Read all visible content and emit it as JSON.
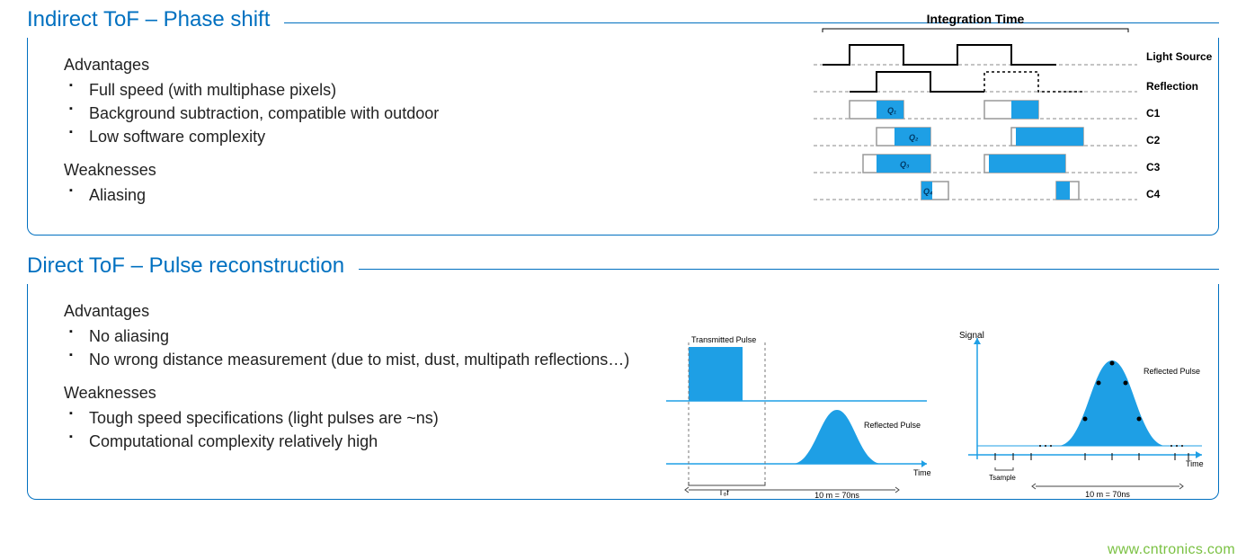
{
  "sections": [
    {
      "title": "Indirect ToF – Phase shift",
      "advantages_label": "Advantages",
      "advantages": [
        "Full speed (with multiphase pixels)",
        "Background subtraction, compatible with outdoor",
        "Low software complexity"
      ],
      "weaknesses_label": "Weaknesses",
      "weaknesses": [
        "Aliasing"
      ],
      "timing": {
        "header": "Integration Time",
        "rows": [
          "Light Source",
          "Reflection",
          "C1",
          "C2",
          "C3",
          "C4"
        ],
        "q_labels": [
          "Q₁",
          "Q₂",
          "Q₃",
          "Q₄"
        ]
      }
    },
    {
      "title": "Direct ToF – Pulse reconstruction",
      "advantages_label": "Advantages",
      "advantages": [
        "No aliasing",
        "No wrong distance measurement  (due to mist, dust, multipath reflections…)"
      ],
      "weaknesses_label": "Weaknesses",
      "weaknesses": [
        "Tough speed specifications (light pulses are ~ns)",
        "Computational complexity relatively high"
      ],
      "pulse_left": {
        "tx": "Transmitted Pulse",
        "rx": "Reflected Pulse",
        "xaxis": "Time",
        "span": "10 m = 70ns",
        "tof": "Tₒf"
      },
      "pulse_right": {
        "yaxis": "Signal",
        "xaxis": "Time",
        "rx": "Reflected Pulse",
        "tsample": "Tsample",
        "span": "10 m = 70ns"
      }
    }
  ],
  "watermark": "www.cntronics.com",
  "colors": {
    "accent": "#0070C0",
    "fill": "#1E9FE5"
  }
}
